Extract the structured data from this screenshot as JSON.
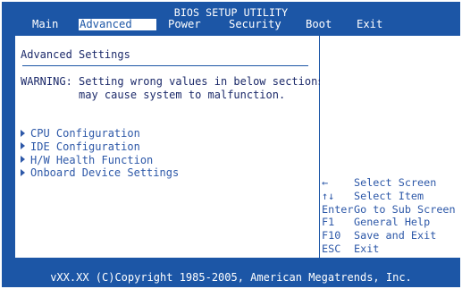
{
  "title": "BIOS SETUP UTILITY",
  "tabs": [
    {
      "label": "Main",
      "active": false
    },
    {
      "label": "Advanced",
      "active": true
    },
    {
      "label": "Power",
      "active": false
    },
    {
      "label": "Security",
      "active": false
    },
    {
      "label": "Boot",
      "active": false
    },
    {
      "label": "Exit",
      "active": false
    }
  ],
  "main": {
    "heading": "Advanced Settings",
    "warning_line1": "WARNING: Setting wrong values in below sections",
    "warning_line2": "         may cause system to malfunction.",
    "menu_items": [
      {
        "label": "CPU Configuration"
      },
      {
        "label": "IDE Configuration"
      },
      {
        "label": "H/W Health Function"
      },
      {
        "label": "Onboard Device Settings"
      }
    ]
  },
  "help": [
    {
      "key": "←",
      "desc": "Select Screen"
    },
    {
      "key": "↑↓",
      "desc": "Select Item"
    },
    {
      "key": "Enter",
      "desc": "Go to Sub Screen"
    },
    {
      "key": "F1",
      "desc": "General Help"
    },
    {
      "key": "F10",
      "desc": "Save and Exit"
    },
    {
      "key": "ESC",
      "desc": "Exit"
    }
  ],
  "footer": "vXX.XX (C)Copyright 1985-2005, American Megatrends, Inc.",
  "colors": {
    "frame_blue": "#1c56a6",
    "panel_white": "#ffffff",
    "menu_text": "#2d58a8"
  }
}
